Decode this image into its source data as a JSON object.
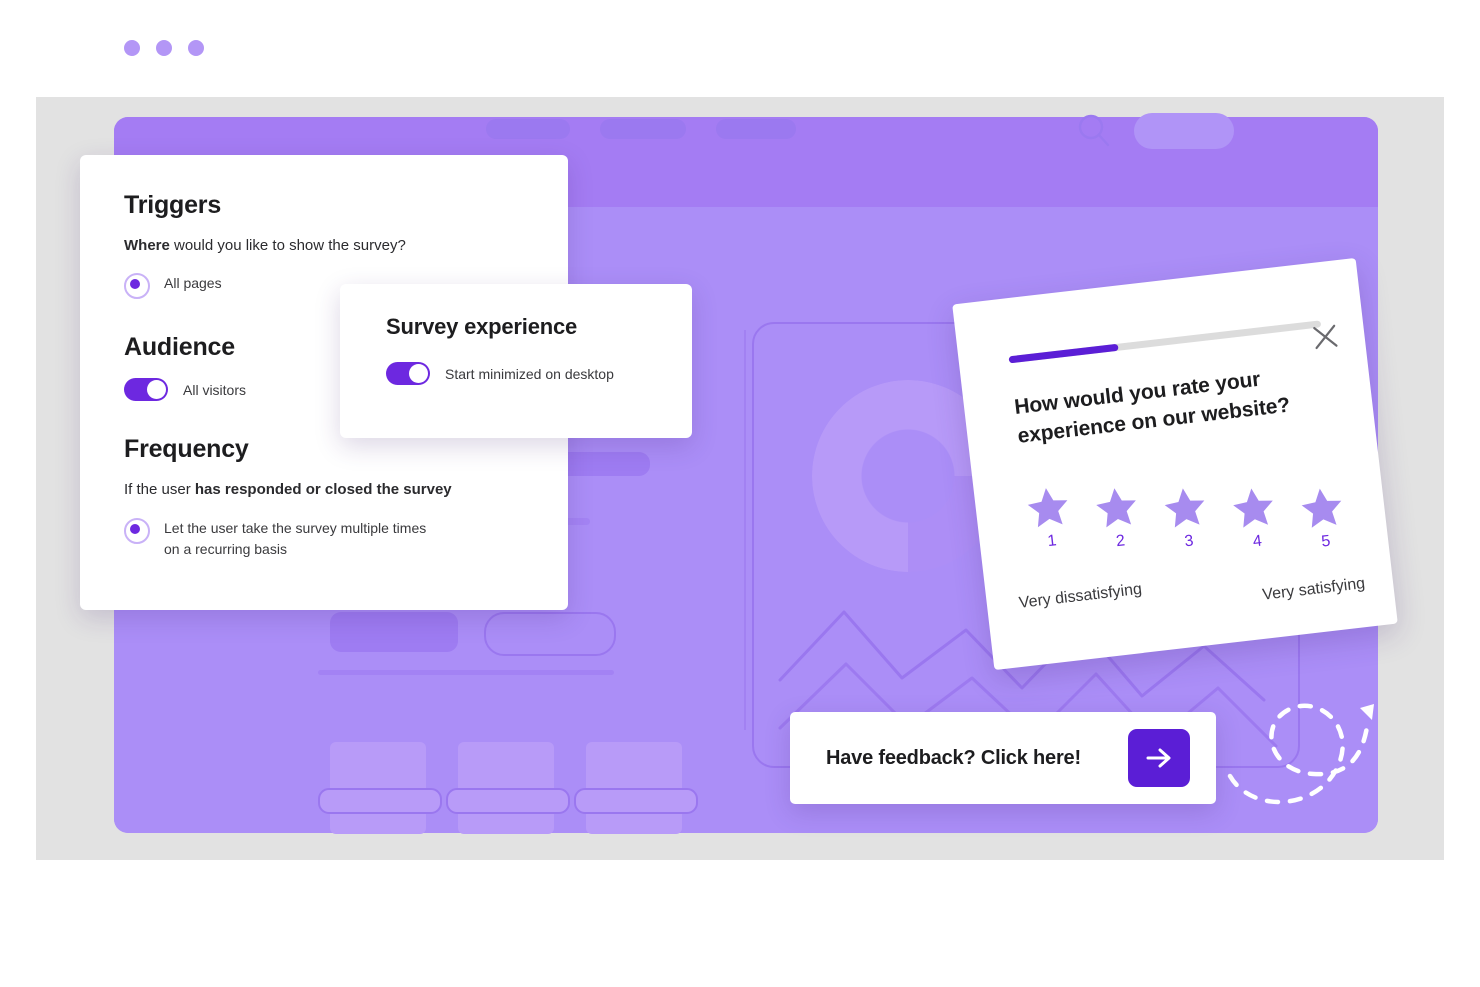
{
  "settings_card": {
    "triggers": {
      "title": "Triggers",
      "question_bold": "Where",
      "question_rest": " would you like to show the survey?",
      "option_label": "All pages"
    },
    "audience": {
      "title": "Audience",
      "toggle_label": "All visitors"
    },
    "frequency": {
      "title": "Frequency",
      "question_plain": "If the user ",
      "question_bold": "has responded or closed the survey",
      "option_label_line1": "Let the user take the survey multiple times",
      "option_label_line2": "on a recurring basis"
    }
  },
  "experience_card": {
    "title": "Survey experience",
    "toggle_label": "Start minimized on desktop"
  },
  "rating_card": {
    "progress_percent": 35,
    "close_icon": "close-icon",
    "question_line1": "How would you rate your",
    "question_line2": "experience on our website?",
    "stars": [
      {
        "number": "1"
      },
      {
        "number": "2"
      },
      {
        "number": "3"
      },
      {
        "number": "4"
      },
      {
        "number": "5"
      }
    ],
    "scale_low": "Very dissatisfying",
    "scale_high": "Very satisfying"
  },
  "feedback_banner": {
    "text": "Have feedback? Click here!",
    "button_icon": "arrow-right-icon"
  },
  "app_mock": {
    "search_icon": "search-icon",
    "window_dots": 3,
    "nav_pills": 3
  },
  "colors": {
    "brand_purple": "#5b1ed6",
    "toggle_purple": "#6d28e0",
    "panel_header": "#a47cf3",
    "panel_body": "#ab8ef7",
    "star_purple": "#a78bef",
    "frame_grey": "#e2e2e2"
  }
}
